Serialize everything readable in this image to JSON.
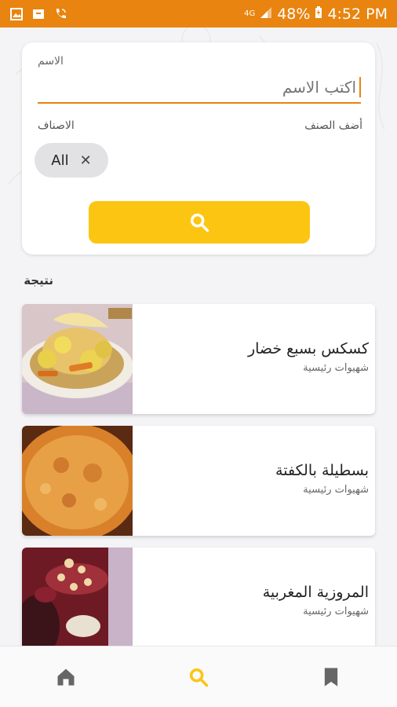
{
  "status_bar": {
    "network": "4G",
    "battery": "48%",
    "time": "4:52 PM",
    "icons": [
      "gallery-icon",
      "box-icon",
      "phone-icon",
      "signal-icon",
      "battery-icon"
    ],
    "bg_color": "#e8840f"
  },
  "search": {
    "name_label": "الاسم",
    "name_placeholder": "اكتب الاسم",
    "categories_label": "الاصناف",
    "add_category_label": "أضف الصنف",
    "selected_chip": "All",
    "button_icon": "search-icon",
    "button_color": "#fcc511"
  },
  "results": {
    "title": "نتيجة",
    "items": [
      {
        "title": "كسكس بسبع خضار",
        "subtitle": "شهيوات رئيسية"
      },
      {
        "title": "بسطيلة بالكفتة",
        "subtitle": "شهيوات رئيسية"
      },
      {
        "title": "المروزية المغربية",
        "subtitle": "شهيوات رئيسية"
      }
    ]
  },
  "nav": {
    "items": [
      "home-icon",
      "search-icon",
      "bookmark-icon"
    ],
    "active": "search-icon",
    "active_color": "#fcc511"
  }
}
